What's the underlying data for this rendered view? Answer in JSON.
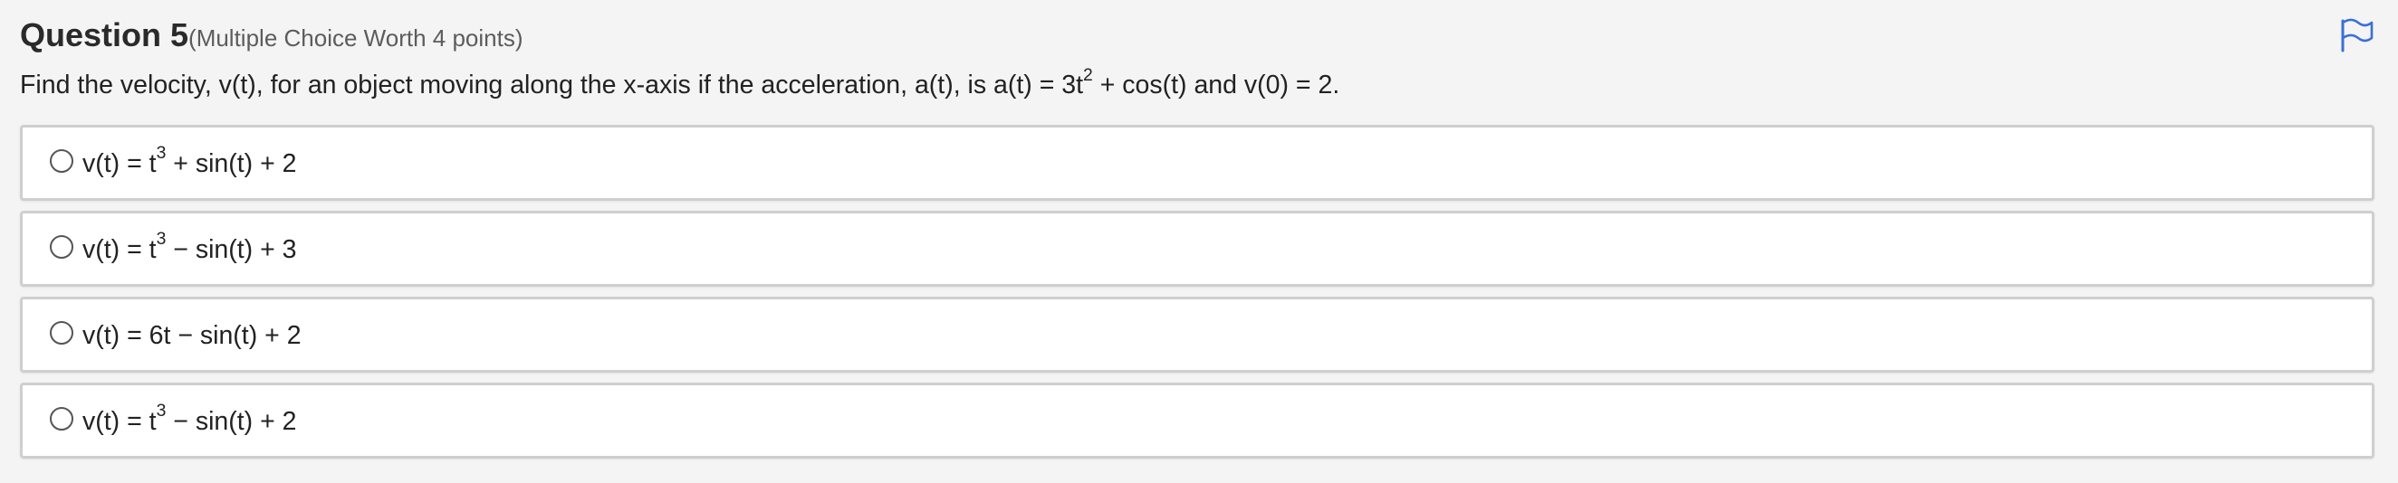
{
  "question": {
    "number_label": "Question 5",
    "meta": "(Multiple Choice Worth 4 points)",
    "flag_icon": "flag-icon",
    "prompt": {
      "before": "Find the velocity, v(t), for an object moving along the x-axis if the acceleration, a(t), is a(t) = 3t",
      "sup": "2",
      "after": " + cos(t) and v(0) = 2."
    }
  },
  "options": [
    {
      "before": "v(t) = t",
      "sup": "3",
      "after": " + sin(t) + 2"
    },
    {
      "before": "v(t) = t",
      "sup": "3",
      "after": " − sin(t) + 3"
    },
    {
      "before": "v(t) = 6t − sin(t) + 2",
      "sup": "",
      "after": ""
    },
    {
      "before": "v(t) = t",
      "sup": "3",
      "after": " − sin(t) + 2"
    }
  ],
  "colors": {
    "flag": "#3a6fd8",
    "option_border": "#cfcfcf",
    "background": "#f4f4f4"
  }
}
